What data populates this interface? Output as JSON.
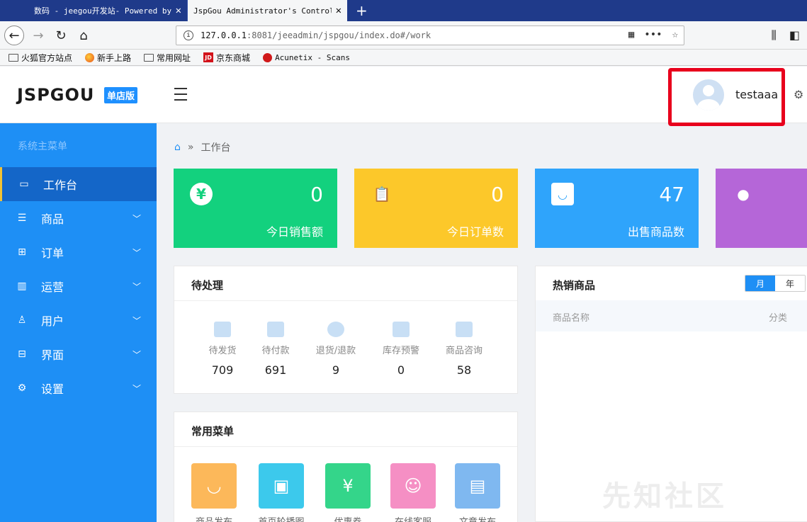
{
  "browser": {
    "tabs": [
      {
        "title": "数码 - jeegou开发站- Powered by",
        "close": "✕"
      },
      {
        "title": "JspGou Administrator's Control",
        "close": "✕"
      }
    ],
    "new_tab": "+",
    "url_host": "127.0.0.1",
    "url_rest": ":8081/jeeadmin/jspgou/index.do#/work",
    "bookmarks": [
      "火狐官方站点",
      "新手上路",
      "常用网址",
      "京东商城",
      "Acunetix - Scans"
    ]
  },
  "header": {
    "logo": "JSPGOU",
    "badge": "单店版",
    "username": "testaaa"
  },
  "sidebar": {
    "title": "系统主菜单",
    "items": [
      {
        "label": "工作台",
        "icon": "monitor-icon",
        "active": true
      },
      {
        "label": "商品",
        "icon": "list-icon"
      },
      {
        "label": "订单",
        "icon": "grid-icon"
      },
      {
        "label": "运营",
        "icon": "bar-chart-icon"
      },
      {
        "label": "用户",
        "icon": "user-icon"
      },
      {
        "label": "界面",
        "icon": "layout-icon"
      },
      {
        "label": "设置",
        "icon": "gear-icon"
      }
    ]
  },
  "breadcrumb": {
    "current": "工作台"
  },
  "stats": [
    {
      "value": "0",
      "label": "今日销售额",
      "color": "#13d17e"
    },
    {
      "value": "0",
      "label": "今日订单数",
      "color": "#fcc82a"
    },
    {
      "value": "47",
      "label": "出售商品数",
      "color": "#2fa4fb"
    },
    {
      "value": "",
      "label": "",
      "color": "#b566d8"
    }
  ],
  "pending": {
    "title": "待处理",
    "items": [
      {
        "label": "待发货",
        "value": "709"
      },
      {
        "label": "待付款",
        "value": "691"
      },
      {
        "label": "退货/退款",
        "value": "9"
      },
      {
        "label": "库存预警",
        "value": "0"
      },
      {
        "label": "商品咨询",
        "value": "58"
      }
    ]
  },
  "hot": {
    "title": "热销商品",
    "toggle": [
      "月",
      "年"
    ],
    "col_name": "商品名称",
    "col_cat": "分类"
  },
  "common_menu": {
    "title": "常用菜单",
    "items": [
      {
        "label": "商品发布",
        "color": "#fcb85a"
      },
      {
        "label": "首页轮播图",
        "color": "#3cc9ec"
      },
      {
        "label": "优惠券",
        "color": "#34d58a"
      },
      {
        "label": "在线客服",
        "color": "#f58fc4"
      },
      {
        "label": "文章发布",
        "color": "#7fb8f0"
      }
    ]
  },
  "watermark": "先知社区"
}
